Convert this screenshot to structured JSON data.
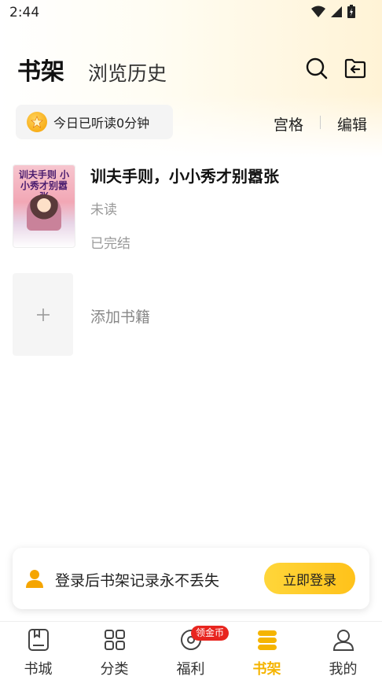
{
  "status_bar": {
    "time": "2:44"
  },
  "header": {
    "active_tab": "书架",
    "inactive_tab": "浏览历史"
  },
  "reading": {
    "text": "今日已听读0分钟"
  },
  "actions": {
    "grid": "宫格",
    "edit": "编辑"
  },
  "books": [
    {
      "title": "训夫手则，小小秀才别嚣张",
      "progress": "未读",
      "status": "已完结",
      "cover_text": "训夫手则 小小秀才别嚣张"
    }
  ],
  "add_book": {
    "label": "添加书籍"
  },
  "login_banner": {
    "text": "登录后书架记录永不丢失",
    "button": "立即登录"
  },
  "bottom_nav": {
    "items": [
      {
        "label": "书城",
        "icon": "bookstore-icon"
      },
      {
        "label": "分类",
        "icon": "category-icon"
      },
      {
        "label": "福利",
        "icon": "welfare-icon",
        "badge": "领金币"
      },
      {
        "label": "书架",
        "icon": "bookshelf-icon",
        "active": true
      },
      {
        "label": "我的",
        "icon": "profile-icon"
      }
    ]
  },
  "colors": {
    "accent": "#f5b400",
    "badge": "#e8251f",
    "login_button": "#ffd02a"
  }
}
